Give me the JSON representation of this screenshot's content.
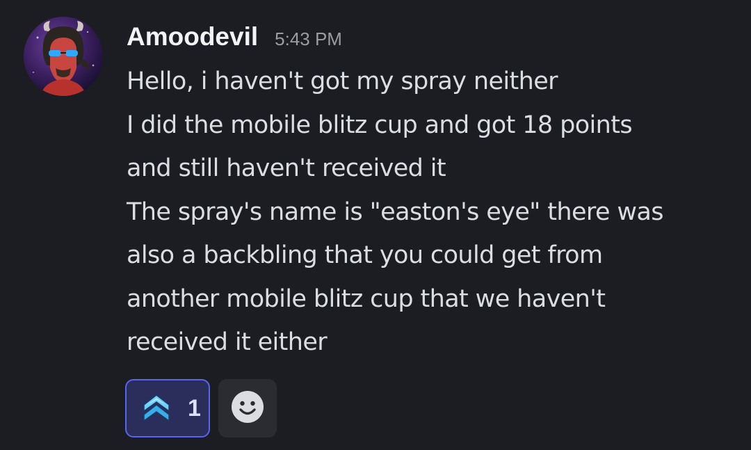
{
  "message": {
    "author": "Amoodevil",
    "timestamp": "5:43 PM",
    "lines": [
      "Hello, i haven't got my spray neither",
      "I did the mobile blitz cup and got 18 points",
      "and still haven't received it",
      "The spray's name is \"easton's eye\" there was",
      "also a backbling that you could get from",
      "another mobile blitz cup that we haven't",
      "received it either"
    ]
  },
  "reactions": [
    {
      "icon": "rank-chevron-icon",
      "count": "1",
      "selected": true
    }
  ],
  "add_reaction": {
    "icon": "smiley-face-icon"
  },
  "colors": {
    "background": "#1c1d22",
    "username": "#f2f3f5",
    "timestamp": "#9b9ca3",
    "text": "#dbdee1",
    "reaction_bg": "#2b2d5b",
    "reaction_border": "#5865f2"
  }
}
